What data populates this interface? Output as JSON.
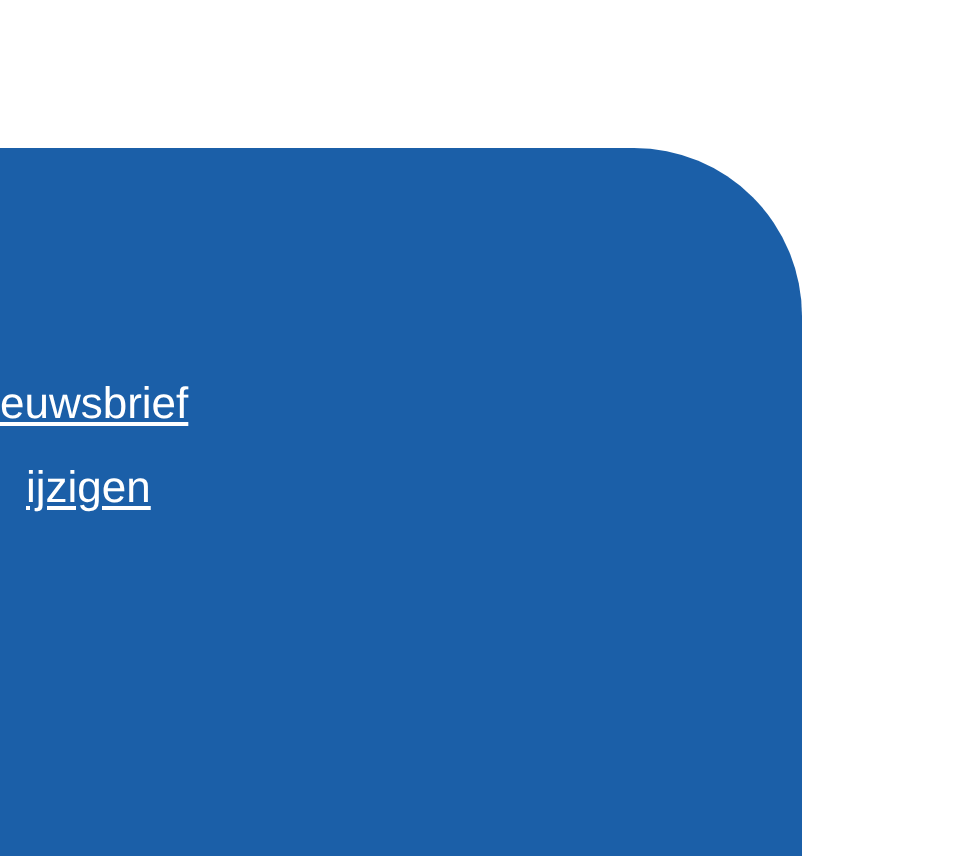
{
  "links": [
    {
      "label": "euwsbrief"
    },
    {
      "label": "ijzigen"
    }
  ]
}
